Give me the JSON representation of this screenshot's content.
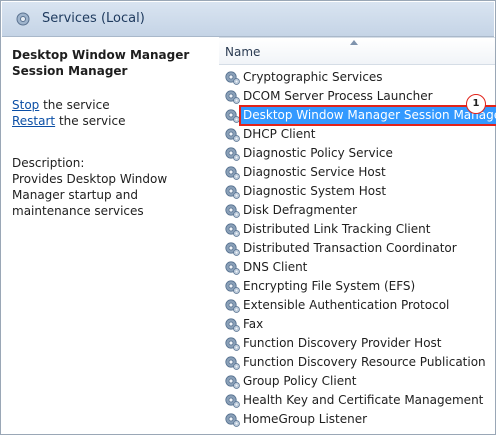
{
  "window": {
    "title": "Services (Local)"
  },
  "details": {
    "service_name": "Desktop Window Manager Session Manager",
    "actions": [
      {
        "link": "Stop",
        "rest": " the service"
      },
      {
        "link": "Restart",
        "rest": " the service"
      }
    ],
    "description_label": "Description:",
    "description_text": "Provides Desktop Window Manager startup and maintenance services"
  },
  "list": {
    "column_header": "Name",
    "items": [
      "Cryptographic Services",
      "DCOM Server Process Launcher",
      "Desktop Window Manager Session Manager",
      "DHCP Client",
      "Diagnostic Policy Service",
      "Diagnostic Service Host",
      "Diagnostic System Host",
      "Disk Defragmenter",
      "Distributed Link Tracking Client",
      "Distributed Transaction Coordinator",
      "DNS Client",
      "Encrypting File System (EFS)",
      "Extensible Authentication Protocol",
      "Fax",
      "Function Discovery Provider Host",
      "Function Discovery Resource Publication",
      "Group Policy Client",
      "Health Key and Certificate Management",
      "HomeGroup Listener"
    ],
    "selected_index": 2
  },
  "annotation": {
    "badge": "1"
  },
  "colors": {
    "selection": "#3399ff",
    "highlight_border": "#e2231a",
    "link": "#0b4fa6",
    "title_bar": "#c5d4e6"
  },
  "icons": {
    "title": "services-gear-icon",
    "service": "gear-icon",
    "sort": "sort-ascending-icon"
  }
}
